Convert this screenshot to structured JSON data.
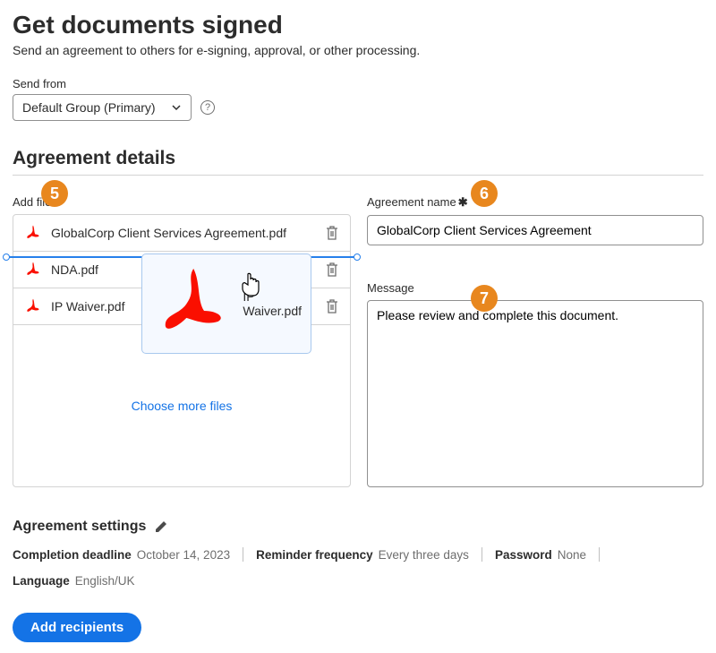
{
  "title": "Get documents signed",
  "subtitle": "Send an agreement to others for e-signing, approval, or other processing.",
  "send_from": {
    "label": "Send from",
    "value": "Default Group (Primary)"
  },
  "section_heading": "Agreement details",
  "files": {
    "label": "Add files",
    "items": [
      {
        "name": "GlobalCorp Client Services Agreement.pdf"
      },
      {
        "name": "NDA.pdf"
      },
      {
        "name": "IP Waiver.pdf"
      }
    ],
    "drag_item": "IP Waiver.pdf",
    "choose_more": "Choose more files"
  },
  "agreement_name": {
    "label": "Agreement name",
    "value": "GlobalCorp Client Services Agreement"
  },
  "message": {
    "label": "Message",
    "value": "Please review and complete this document."
  },
  "badges": {
    "b5": "5",
    "b6": "6",
    "b7": "7"
  },
  "settings": {
    "heading": "Agreement settings",
    "completion_deadline": {
      "k": "Completion deadline",
      "v": "October 14, 2023"
    },
    "reminder": {
      "k": "Reminder frequency",
      "v": "Every three days"
    },
    "password": {
      "k": "Password",
      "v": "None"
    },
    "language": {
      "k": "Language",
      "v": "English/UK"
    }
  },
  "cta": "Add recipients"
}
